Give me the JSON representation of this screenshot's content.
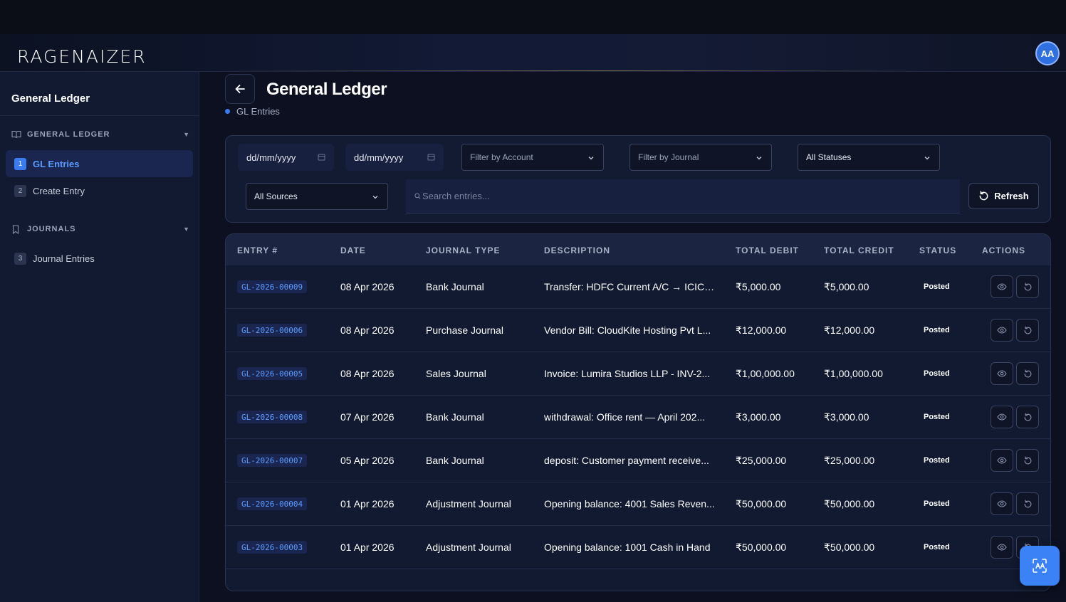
{
  "app": {
    "logo": "RAGENAIZER",
    "avatar_initials": "AA"
  },
  "sidebar": {
    "title": "General Ledger",
    "sections": [
      {
        "label": "GENERAL LEDGER",
        "icon": "book-icon"
      },
      {
        "label": "JOURNALS",
        "icon": "bookmark-icon"
      }
    ],
    "items": [
      {
        "num": "1",
        "label": "GL Entries",
        "active": true
      },
      {
        "num": "2",
        "label": "Create Entry",
        "active": false
      },
      {
        "num": "3",
        "label": "Journal Entries",
        "active": false
      }
    ]
  },
  "page": {
    "title": "General Ledger",
    "breadcrumb": "GL Entries"
  },
  "filters": {
    "date_from_placeholder": "dd/mm/yyyy",
    "date_to_placeholder": "dd/mm/yyyy",
    "account": "Filter by Account",
    "journal": "Filter by Journal",
    "status": "All Statuses",
    "source": "All Sources",
    "search_placeholder": "Search entries...",
    "refresh_label": "Refresh"
  },
  "table": {
    "columns": [
      "ENTRY #",
      "DATE",
      "JOURNAL TYPE",
      "DESCRIPTION",
      "TOTAL DEBIT",
      "TOTAL CREDIT",
      "STATUS",
      "ACTIONS"
    ],
    "rows": [
      {
        "entry": "GL-2026-00009",
        "date": "08 Apr 2026",
        "journal": "Bank Journal",
        "description": "Transfer: HDFC Current A/C → ICICI...",
        "debit": "₹5,000.00",
        "credit": "₹5,000.00",
        "status": "Posted"
      },
      {
        "entry": "GL-2026-00006",
        "date": "08 Apr 2026",
        "journal": "Purchase Journal",
        "description": "Vendor Bill: CloudKite Hosting Pvt L...",
        "debit": "₹12,000.00",
        "credit": "₹12,000.00",
        "status": "Posted"
      },
      {
        "entry": "GL-2026-00005",
        "date": "08 Apr 2026",
        "journal": "Sales Journal",
        "description": "Invoice: Lumira Studios LLP - INV-2...",
        "debit": "₹1,00,000.00",
        "credit": "₹1,00,000.00",
        "status": "Posted"
      },
      {
        "entry": "GL-2026-00008",
        "date": "07 Apr 2026",
        "journal": "Bank Journal",
        "description": "withdrawal: Office rent — April 202...",
        "debit": "₹3,000.00",
        "credit": "₹3,000.00",
        "status": "Posted"
      },
      {
        "entry": "GL-2026-00007",
        "date": "05 Apr 2026",
        "journal": "Bank Journal",
        "description": "deposit: Customer payment receive...",
        "debit": "₹25,000.00",
        "credit": "₹25,000.00",
        "status": "Posted"
      },
      {
        "entry": "GL-2026-00004",
        "date": "01 Apr 2026",
        "journal": "Adjustment Journal",
        "description": "Opening balance: 4001 Sales Reven...",
        "debit": "₹50,000.00",
        "credit": "₹50,000.00",
        "status": "Posted"
      },
      {
        "entry": "GL-2026-00003",
        "date": "01 Apr 2026",
        "journal": "Adjustment Journal",
        "description": "Opening balance: 1001 Cash in Hand",
        "debit": "₹50,000.00",
        "credit": "₹50,000.00",
        "status": "Posted"
      }
    ]
  },
  "colors": {
    "accent": "#3a7bf0",
    "background": "#0c1020",
    "panel": "#131b33"
  }
}
